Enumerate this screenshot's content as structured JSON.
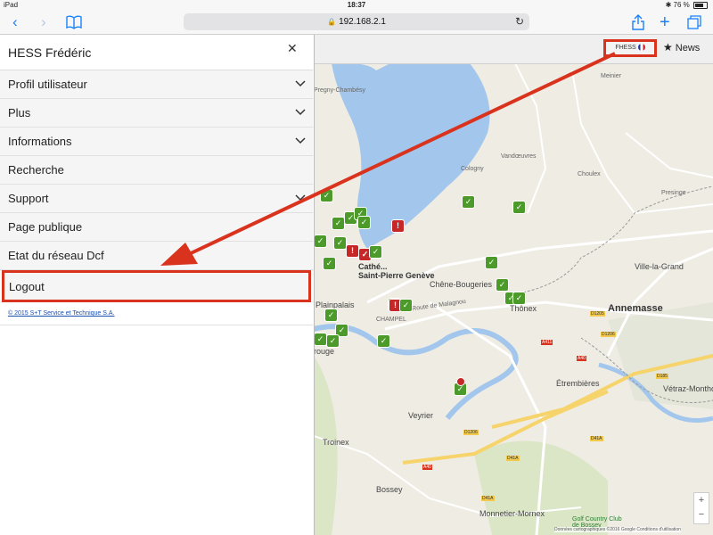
{
  "status_bar": {
    "device": "iPad",
    "time": "18:37",
    "battery": "76 %"
  },
  "browser": {
    "url": "192.168.2.1"
  },
  "menu": {
    "title": "HESS Frédéric",
    "items": [
      {
        "label": "Profil utilisateur",
        "expandable": true
      },
      {
        "label": "Plus",
        "expandable": true
      },
      {
        "label": "Informations",
        "expandable": true
      },
      {
        "label": "Recherche",
        "expandable": false
      },
      {
        "label": "Support",
        "expandable": true
      },
      {
        "label": "Page publique",
        "expandable": false
      },
      {
        "label": "Etat du réseau Dcf",
        "expandable": false
      }
    ],
    "logout_label": "Logout",
    "copyright": "© 2015 S+T Service et Technique S.A."
  },
  "header": {
    "user_label": "FHESS",
    "news_label": "News"
  },
  "map": {
    "labels": {
      "pregny": "Pregny-Chambésy",
      "meinier": "Meinier",
      "cologny": "Cologny",
      "vandoeuvres": "Vandœuvres",
      "choulex": "Choulex",
      "presinge": "Presinge",
      "saint_pierre": "Cathé...\nSaint-Pierre Genève",
      "plainpalais": "Plainpalais",
      "champel": "CHAMPEL",
      "chene_bougeries": "Chêne-Bougeries",
      "thonex": "Thônex",
      "annemasse": "Annemasse",
      "ville_la_grand": "Ville-la-Grand",
      "etrembieres": "Étrembières",
      "vetraz": "Vétraz-Monthoux",
      "veyrier": "Veyrier",
      "troinex": "Troinex",
      "bossey": "Bossey",
      "monnetier": "Monnetier-Mornex",
      "golf": "Golf Country Club de Bossey",
      "route_malagnou": "Route de Malagnou",
      "carouge": "rouge"
    },
    "attribution": "Données cartographiques ©2016 Google   Conditions d'utilisation",
    "zoom_in": "+",
    "zoom_out": "−"
  },
  "colors": {
    "accent": "#d9331e",
    "marker_ok": "#4c9b2a",
    "marker_alert": "#c62828",
    "lake": "#a3c6ec",
    "link": "#1a4fb0"
  }
}
